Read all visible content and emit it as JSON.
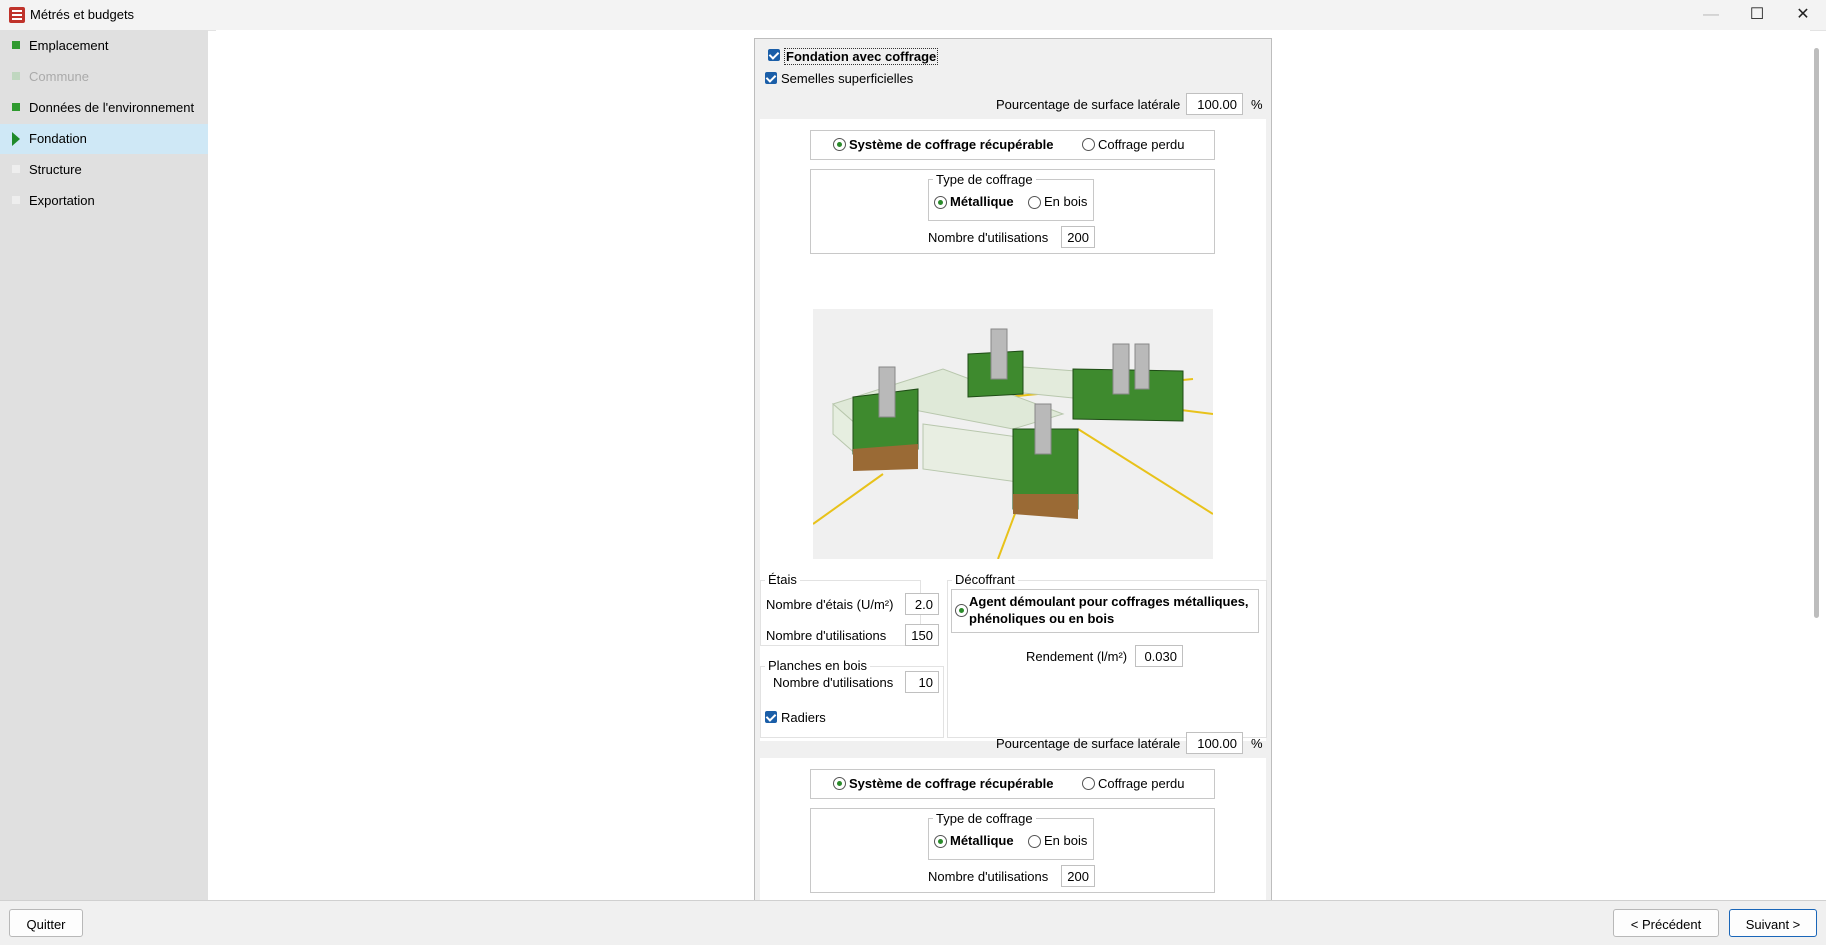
{
  "window": {
    "title": "Métrés et budgets",
    "minimize_glyph": "—",
    "maximize_glyph": "☐",
    "close_glyph": "✕"
  },
  "sidebar": {
    "items": [
      {
        "label": "Emplacement",
        "icon": "green-square-icon",
        "state": "done"
      },
      {
        "label": "Commune",
        "icon": "green-square-icon",
        "state": "disabled"
      },
      {
        "label": "Données de l'environnement",
        "icon": "green-square-icon",
        "state": "done"
      },
      {
        "label": "Fondation",
        "icon": "arrow-right-icon",
        "state": "active"
      },
      {
        "label": "Structure",
        "icon": "blank-square-icon",
        "state": "pending"
      },
      {
        "label": "Exportation",
        "icon": "blank-square-icon",
        "state": "pending"
      }
    ]
  },
  "form": {
    "fondation_avec_coffrage": {
      "label": "Fondation avec coffrage",
      "checked": true
    },
    "semelles": {
      "label": "Semelles superficielles",
      "checked": true,
      "pourcentage_label": "Pourcentage de surface latérale",
      "pourcentage_value": "100.00",
      "pourcentage_unit": "%",
      "systeme_recuperable": "Système de coffrage récupérable",
      "coffrage_perdu": "Coffrage perdu",
      "type_legend": "Type de coffrage",
      "metallique": "Métallique",
      "en_bois": "En bois",
      "nombre_utilisations_label": "Nombre d'utilisations",
      "nombre_utilisations_value": "200",
      "etais": {
        "legend": "Étais",
        "nombre_etais_label": "Nombre d'étais (U/m²)",
        "nombre_etais_value": "2.0",
        "nombre_utilisations_label": "Nombre d'utilisations",
        "nombre_utilisations_value": "150"
      },
      "planches": {
        "legend": "Planches en bois",
        "nombre_utilisations_label": "Nombre d'utilisations",
        "nombre_utilisations_value": "10"
      },
      "decoffrant": {
        "legend": "Décoffrant",
        "agent_line1": "Agent démoulant pour coffrages métalliques,",
        "agent_line2": "phénoliques ou en bois",
        "rendement_label": "Rendement (l/m²)",
        "rendement_value": "0.030"
      }
    },
    "radiers": {
      "label": "Radiers",
      "checked": true,
      "pourcentage_label": "Pourcentage de surface latérale",
      "pourcentage_value": "100.00",
      "pourcentage_unit": "%",
      "systeme_recuperable": "Système de coffrage récupérable",
      "coffrage_perdu": "Coffrage perdu",
      "type_legend": "Type de coffrage",
      "metallique": "Métallique",
      "en_bois": "En bois",
      "nombre_utilisations_label": "Nombre d'utilisations",
      "nombre_utilisations_value": "200"
    }
  },
  "footer": {
    "quit_label": "Quitter",
    "prev_label": "< Précédent",
    "next_label": "Suivant >"
  },
  "colors": {
    "accent_green": "#2a8a2a",
    "checkbox_blue": "#1a5ea8",
    "active_item_bg": "#cfe8f6"
  }
}
